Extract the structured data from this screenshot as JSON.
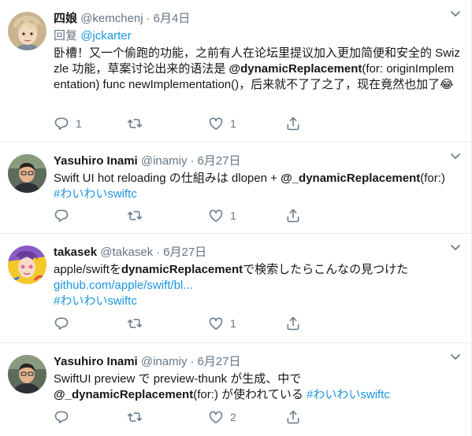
{
  "tweets": [
    {
      "name": "四娘",
      "handle": "@kemchenj",
      "date": "6月4日",
      "reply_prefix": "回复",
      "reply_to": "@jckarter",
      "text_1": "卧槽！又一个偷跑的功能，之前有人在论坛里提议加入更加简便和安全的 Swizzle 功能，草案讨论出来的语法是 ",
      "text_bold": "@dynamicReplacement",
      "text_2": "(for: originImplementation) func newImplementation()，后来就不了了之了，现在竟然也加了",
      "emoji": "😂",
      "replies": "1",
      "retweets": "",
      "likes": "1"
    },
    {
      "name": "Yasuhiro Inami",
      "handle": "@inamiy",
      "date": "6月27日",
      "text_1": "Swift UI hot reloading の仕組みは dlopen + ",
      "text_bold": "@_dynamicReplacement",
      "text_2": "(for:)",
      "hashtag": "#わいわいswiftc",
      "replies": "",
      "retweets": "",
      "likes": "1"
    },
    {
      "name": "takasek",
      "handle": "@takasek",
      "date": "6月27日",
      "text_1": "apple/swiftを",
      "text_bold": "dynamicReplacement",
      "text_2": "で検索したらこんなの見つけた",
      "url": "github.com/apple/swift/bl...",
      "hashtag": "#わいわいswiftc",
      "replies": "",
      "retweets": "",
      "likes": "1"
    },
    {
      "name": "Yasuhiro Inami",
      "handle": "@inamiy",
      "date": "6月27日",
      "text_1": "SwiftUI preview で preview-thunk が生成、中で",
      "text_bold": "@_dynamicReplacement",
      "text_2": "(for:) が使われている ",
      "hashtag": "#わいわいswiftc",
      "replies": "",
      "retweets": "",
      "likes": "2"
    }
  ],
  "separator": "·",
  "colors": {
    "link": "#1b95e0",
    "muted": "#657786",
    "border": "#e6ecf0"
  },
  "icons": [
    "reply-icon",
    "retweet-icon",
    "like-icon",
    "share-icon",
    "caret-down-icon"
  ]
}
